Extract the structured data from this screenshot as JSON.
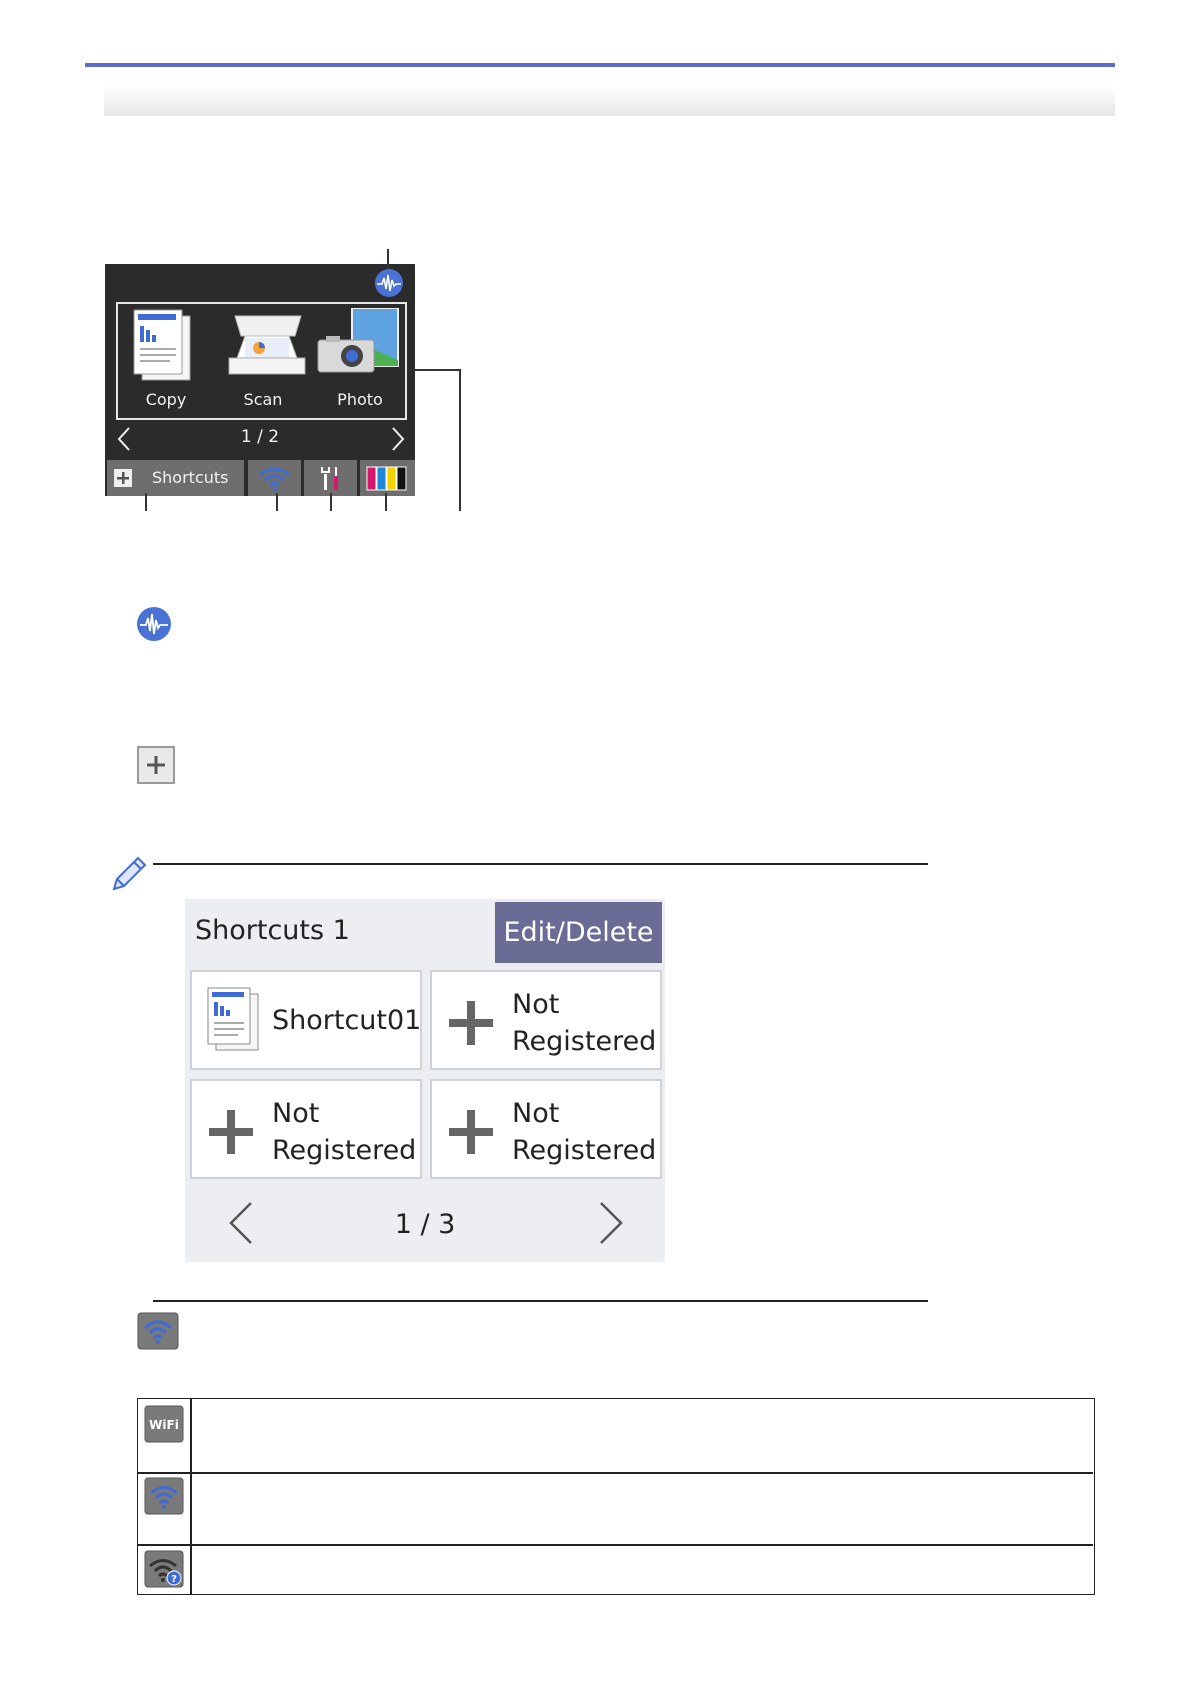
{
  "lcd": {
    "functions": [
      {
        "label": "Copy",
        "icon": "copy-icon"
      },
      {
        "label": "Scan",
        "icon": "scan-icon"
      },
      {
        "label": "Photo",
        "icon": "photo-icon"
      }
    ],
    "page_indicator": "1 / 2",
    "shortcuts_label": "Shortcuts",
    "status_icons": [
      "wifi-icon",
      "settings-icon",
      "ink-icon"
    ],
    "quiet_mode_icon": "quiet-mode-icon",
    "ink_colors": [
      "#d6186e",
      "#1e88d6",
      "#f2d200",
      "#111111"
    ]
  },
  "shortcuts_screen": {
    "title": "Shortcuts 1",
    "edit_button": "Edit/Delete",
    "tiles": [
      {
        "line1": "Shortcut01",
        "line2": "",
        "icon": "copy-icon"
      },
      {
        "line1": "Not",
        "line2": "Registered",
        "icon": "plus-icon"
      },
      {
        "line1": "Not",
        "line2": "Registered",
        "icon": "plus-icon"
      },
      {
        "line1": "Not",
        "line2": "Registered",
        "icon": "plus-icon"
      }
    ],
    "page_indicator": "1 / 3"
  },
  "wifi_table_icons": [
    "wifi-text-icon",
    "wifi-connected-icon",
    "wifi-unknown-icon"
  ],
  "colors": {
    "accent": "#5b6bd1",
    "edit_button": "#6a6c96",
    "icon_blue": "#3f6bd6"
  }
}
